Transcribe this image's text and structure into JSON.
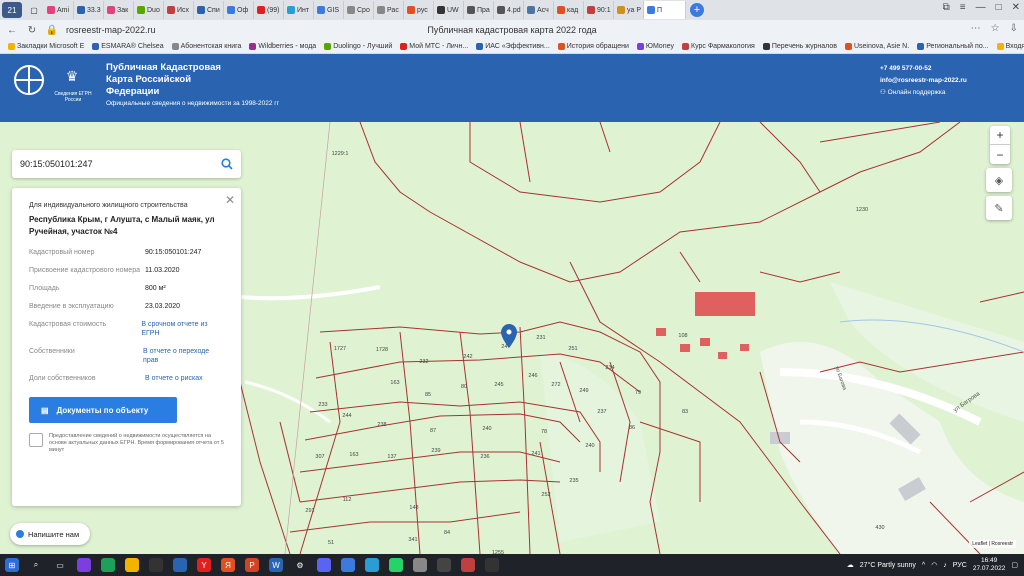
{
  "browser": {
    "tab_counter": "21",
    "tabs": [
      {
        "label": "Ami",
        "color": "#e0447a"
      },
      {
        "label": "33.3",
        "color": "#2a64b0"
      },
      {
        "label": "Зак",
        "color": "#e0447a"
      },
      {
        "label": "Duo",
        "color": "#58a700"
      },
      {
        "label": "Исх",
        "color": "#c04040"
      },
      {
        "label": "Спи",
        "color": "#2a64b0"
      },
      {
        "label": "Оф",
        "color": "#3b7be0"
      },
      {
        "label": "(99)",
        "color": "#e02020"
      },
      {
        "label": "Инт",
        "color": "#2a9dd4"
      },
      {
        "label": "GIS",
        "color": "#3b7be0"
      },
      {
        "label": "Сро",
        "color": "#888888"
      },
      {
        "label": "Рас",
        "color": "#888888"
      },
      {
        "label": "рус",
        "color": "#e05020"
      },
      {
        "label": "UW",
        "color": "#333333"
      },
      {
        "label": "Пра",
        "color": "#555555"
      },
      {
        "label": "4.pd",
        "color": "#555555"
      },
      {
        "label": "Асч",
        "color": "#4c75a3"
      },
      {
        "label": "кад",
        "color": "#e05020"
      },
      {
        "label": "90:1",
        "color": "#c04040"
      },
      {
        "label": "ya P",
        "color": "#d09020"
      },
      {
        "label": "П",
        "color": "#3b7be0"
      }
    ],
    "url": "rosreestr-map-2022.ru",
    "page_title": "Публичная кадастровая карта 2022 года",
    "bookmarks": [
      {
        "label": "Закладки Microsoft E",
        "color": "#f2b400"
      },
      {
        "label": "ESMARA® Chelsea",
        "color": "#2a64b0"
      },
      {
        "label": "Абонентская книга",
        "color": "#888888"
      },
      {
        "label": "Wildberries - мода",
        "color": "#9b2d8f"
      },
      {
        "label": "Duolingo - Лучший",
        "color": "#58a700"
      },
      {
        "label": "Мой МТС - Личн...",
        "color": "#e02020"
      },
      {
        "label": "ИАС «Эффективн...",
        "color": "#2a64b0"
      },
      {
        "label": "История обращени",
        "color": "#e05020"
      },
      {
        "label": "ЮMoney",
        "color": "#7b3fe0"
      },
      {
        "label": "Курс Фармакология",
        "color": "#c04040"
      },
      {
        "label": "Перечень журналов",
        "color": "#333333"
      },
      {
        "label": "Useinova, Asie N.",
        "color": "#e05020"
      },
      {
        "label": "Региональный по...",
        "color": "#2a64b0"
      },
      {
        "label": "Входящие -",
        "color": "#f2b400"
      }
    ]
  },
  "site": {
    "emblem_text": "Сведения ЕГРН России",
    "title": "Публичная Кадастровая Карта Российской Федерации",
    "subtitle": "Официальные сведения о недвижимости за 1998-2022 гг",
    "phone": "+7 499 577-00-52",
    "email": "info@rosreestr-map-2022.ru",
    "support": "Онлайн поддержка"
  },
  "search": {
    "value": "90:15:050101:247"
  },
  "object": {
    "type": "Для индивидуального жилищного строительства",
    "address": "Республика Крым, г Алушта, с Малый маяк, ул Ручейная, участок №4",
    "rows": [
      {
        "key": "Кадастровый номер",
        "value": "90:15:050101:247",
        "link": false
      },
      {
        "key": "Присвоение кадастрового номера",
        "value": "11.03.2020",
        "link": false
      },
      {
        "key": "Площадь",
        "value": "800 м²",
        "link": false
      },
      {
        "key": "Введение в эксплуатацию",
        "value": "23.03.2020",
        "link": false
      },
      {
        "key": "Кадастровая стоимость",
        "value": "В срочном отчете из ЕГРН",
        "link": true
      },
      {
        "key": "Собственники",
        "value": "В отчете о переходе прав",
        "link": true
      },
      {
        "key": "Доли собственников",
        "value": "В отчете о рисках",
        "link": true
      }
    ],
    "docs_button": "Документы по объекту",
    "note": "Предоставление сведений о недвижимости осуществляется на основе актуальных данных ЕГРН. Время формирования отчета от 5 минут"
  },
  "map": {
    "chat_label": "Напишите нам",
    "attribution": "Leaflet | Rosreestr",
    "zoom_in": "+",
    "zoom_out": "−",
    "street_label": "ул Багрова",
    "street_label_2": "ул Багова",
    "labels": [
      "1229:1",
      "1230",
      "1727",
      "1728",
      "232",
      "242",
      "247",
      "231",
      "251",
      "234",
      "163",
      "85",
      "80",
      "245",
      "246",
      "272",
      "249",
      "79",
      "233",
      "244",
      "238",
      "87",
      "240",
      "78",
      "237",
      "86",
      "83",
      "307",
      "163",
      "137",
      "239",
      "236",
      "241",
      "240",
      "112",
      "235",
      "252",
      "291",
      "148",
      "84",
      "51",
      "341",
      "108",
      "430",
      "1255"
    ]
  },
  "taskbar": {
    "weather": "27°C Partly sunny",
    "time": "16:49",
    "date": "27.07.2022",
    "lang": "РУС"
  }
}
